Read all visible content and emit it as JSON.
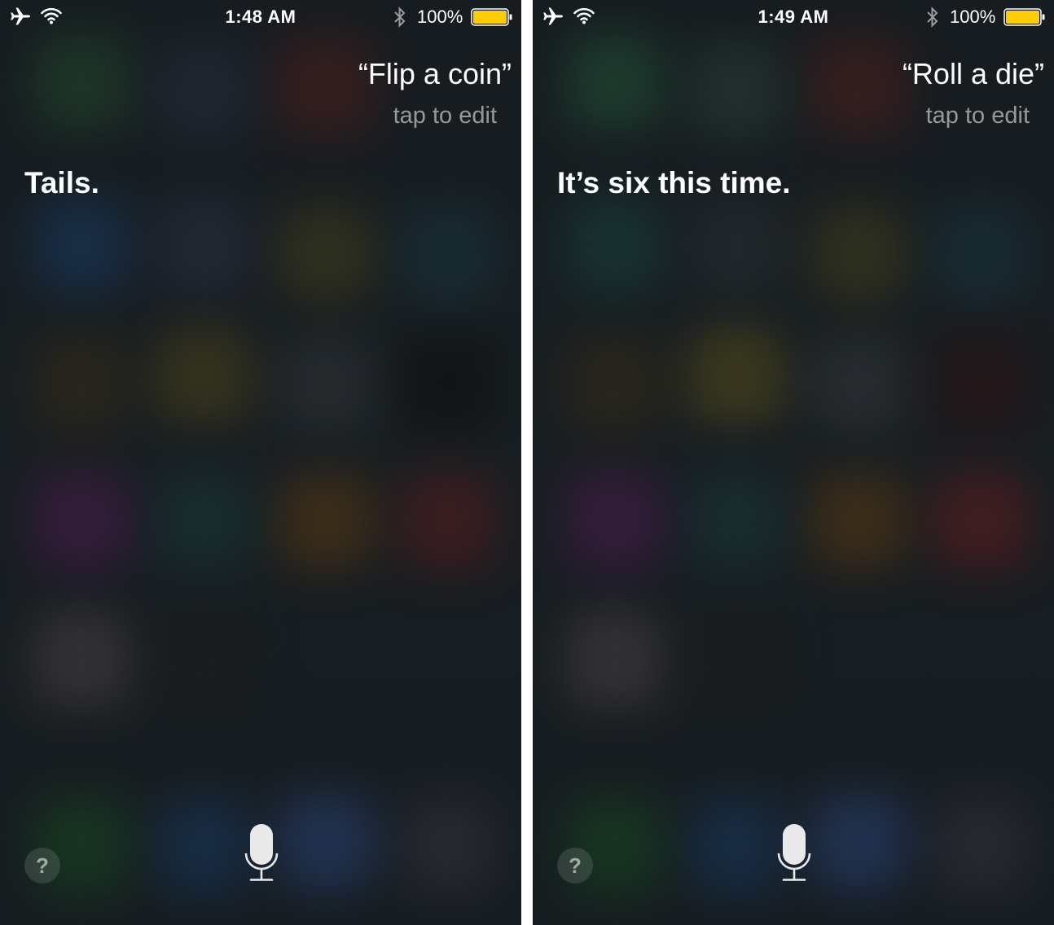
{
  "screens": [
    {
      "status": {
        "time": "1:48 AM",
        "battery": "100%"
      },
      "query": "“Flip a coin”",
      "edit_hint": "tap to edit",
      "answer": "Tails.",
      "help": "?"
    },
    {
      "status": {
        "time": "1:49 AM",
        "battery": "100%"
      },
      "query": "“Roll a die”",
      "edit_hint": "tap to edit",
      "answer": "It’s six this time.",
      "help": "?"
    }
  ],
  "icons": {
    "airplane": "airplane-icon",
    "wifi": "wifi-icon",
    "bluetooth": "bluetooth-icon",
    "battery": "battery-icon",
    "microphone": "microphone-icon",
    "help": "question-mark"
  },
  "colors": {
    "battery_fill": "#ffcc00",
    "background": "#1c2327",
    "text_secondary": "#8c9094"
  }
}
